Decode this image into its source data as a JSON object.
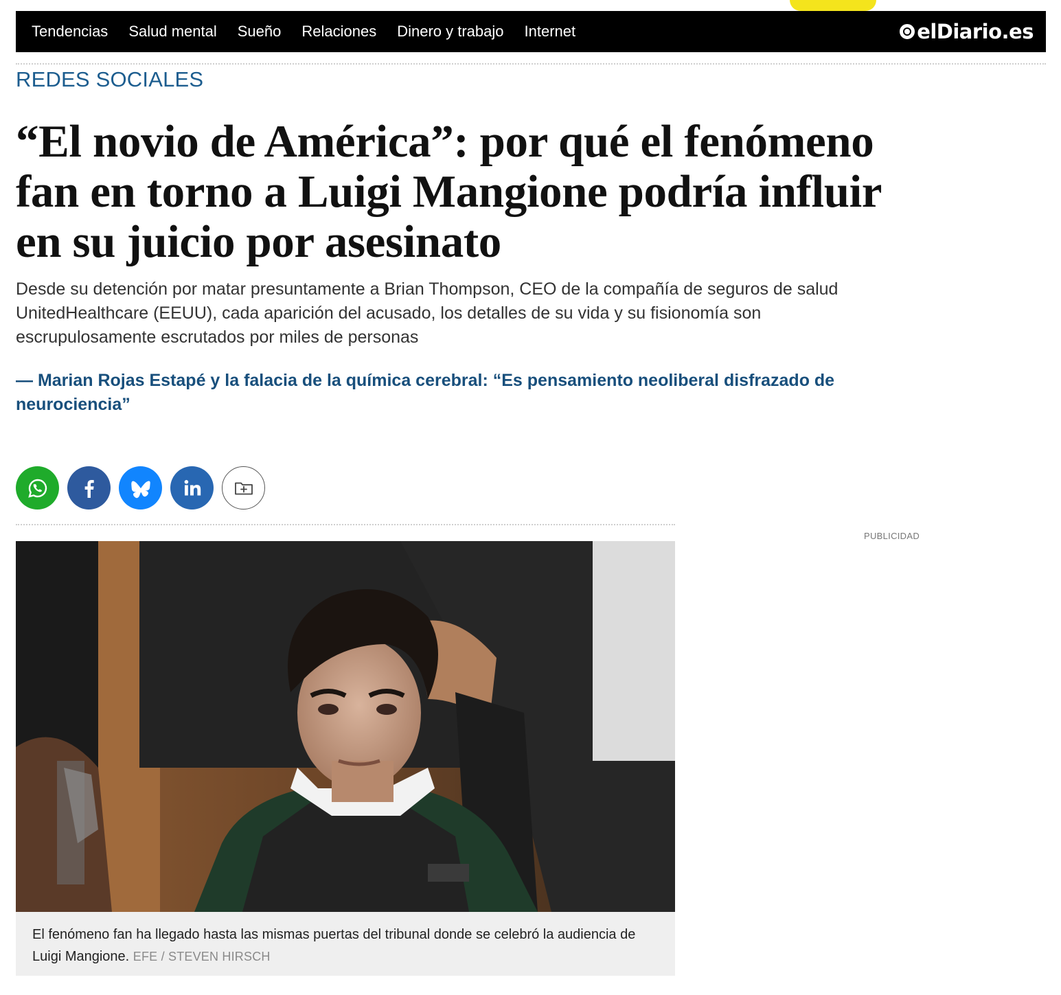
{
  "nav": {
    "links": [
      "Tendencias",
      "Salud mental",
      "Sueño",
      "Relaciones",
      "Dinero y trabajo",
      "Internet"
    ],
    "logo_text": "elDiario.es"
  },
  "article": {
    "section": "REDES SOCIALES",
    "headline": "“El novio de América”: por qué el fenómeno fan en torno a Luigi Mangione podría influir en su juicio por asesinato",
    "standfirst": "Desde su detención por matar presuntamente a Brian Thompson, CEO de la compañía de seguros de salud UnitedHealthcare (EEUU), cada aparición del acusado, los detalles de su vida y su fisionomía son escrupulosamente escrutados por miles de personas",
    "related": "— Marian Rojas Estapé y la falacia de la química cerebral: “Es pensamiento neoliberal disfrazado de neurociencia”",
    "caption": "El fenómeno fan ha llegado hasta las mismas puertas del tribunal donde se celebró la audiencia de Luigi Mangione.",
    "caption_credit": "EFE / STEVEN HIRSCH"
  },
  "share": {
    "buttons": [
      {
        "icon": "whatsapp-icon",
        "color": "#1fab2b"
      },
      {
        "icon": "facebook-icon",
        "color": "#2e5a9e"
      },
      {
        "icon": "bluesky-icon",
        "color": "#1185fe"
      },
      {
        "icon": "linkedin-icon",
        "color": "#2867b2"
      },
      {
        "icon": "save-folder-icon",
        "color": "#ffffff"
      }
    ]
  },
  "ad": {
    "label": "PUBLICIDAD"
  },
  "colors": {
    "nav_bg": "#000000",
    "accent_blue": "#1c5d8f",
    "related_blue": "#184f7c",
    "top_tab_yellow": "#f4e41c"
  }
}
